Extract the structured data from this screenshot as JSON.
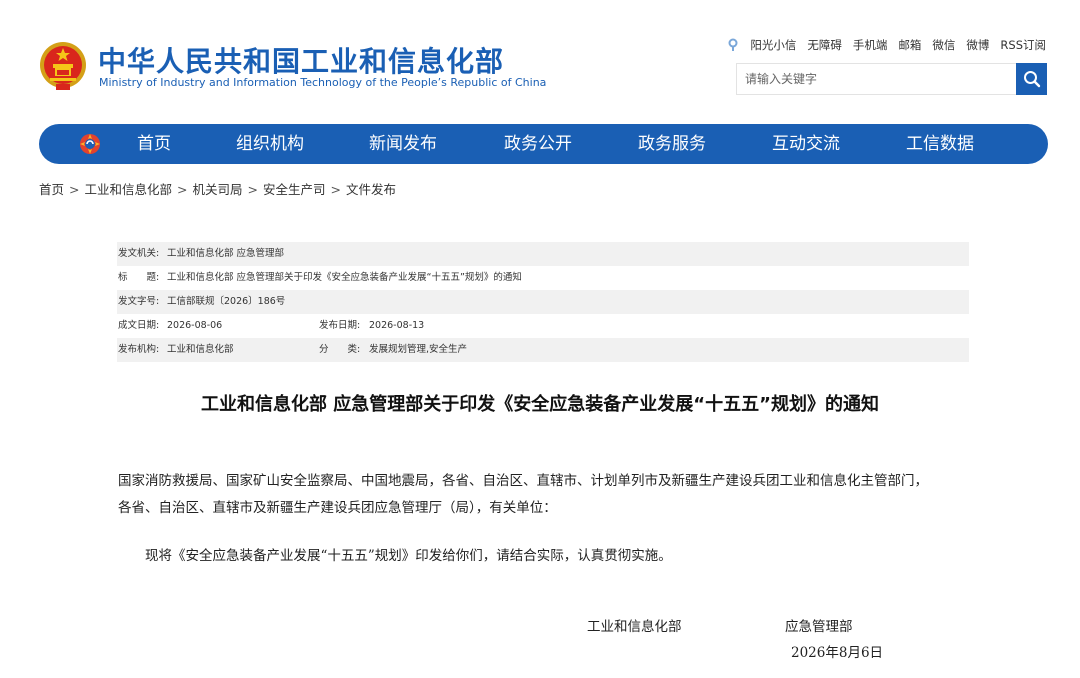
{
  "site": {
    "title_cn": "中华人民共和国工业和信息化部",
    "title_en": "Ministry of Industry and Information Technology of the People’s Republic of China"
  },
  "top_links": [
    "阳光小信",
    "无障碍",
    "手机端",
    "邮箱",
    "微信",
    "微博",
    "RSS订阅"
  ],
  "search": {
    "placeholder": "请输入关键字"
  },
  "nav": {
    "items": [
      "首页",
      "组织机构",
      "新闻发布",
      "政务公开",
      "政务服务",
      "互动交流",
      "工信数据"
    ]
  },
  "breadcrumb": [
    "首页",
    "工业和信息化部",
    "机关司局",
    "安全生产司",
    "文件发布"
  ],
  "breadcrumb_sep": ">",
  "info": {
    "issuer_label": "发文机关:",
    "issuer": "工业和信息化部 应急管理部",
    "title_label": "标　　题:",
    "title": "工业和信息化部 应急管理部关于印发《安全应急装备产业发展“十五五”规划》的通知",
    "docno_label": "发文字号:",
    "docno": "工信部联规〔2026〕186号",
    "created_label": "成文日期:",
    "created": "2026-08-06",
    "published_label": "发布日期:",
    "published": "2026-08-13",
    "publisher_label": "发布机构:",
    "publisher": "工业和信息化部",
    "category_label": "分　　类:",
    "category": "发展规划管理,安全生产"
  },
  "doc": {
    "title": "工业和信息化部 应急管理部关于印发《安全应急装备产业发展“十五五”规划》的通知",
    "recipients_line1": "国家消防救援局、国家矿山安全监察局、中国地震局，各省、自治区、直辖市、计划单列市及新疆生产建设兵团工业和信息化主管部门，",
    "recipients_line2": "各省、自治区、直辖市及新疆生产建设兵团应急管理厅（局），有关单位：",
    "body": "现将《安全应急装备产业发展“十五五”规划》印发给你们，请结合实际，认真贯彻实施。",
    "sign_1": "工业和信息化部",
    "sign_2": "应急管理部",
    "date": "2026年8月6日"
  },
  "colors": {
    "brand_blue": "#1a5fb4",
    "row_shade": "#f1f1f1"
  },
  "icons": {
    "emblem": "national-emblem-icon",
    "nav_logo": "miit-logo-icon",
    "search": "search-icon",
    "xiaoxin": "xiaoxin-icon"
  }
}
